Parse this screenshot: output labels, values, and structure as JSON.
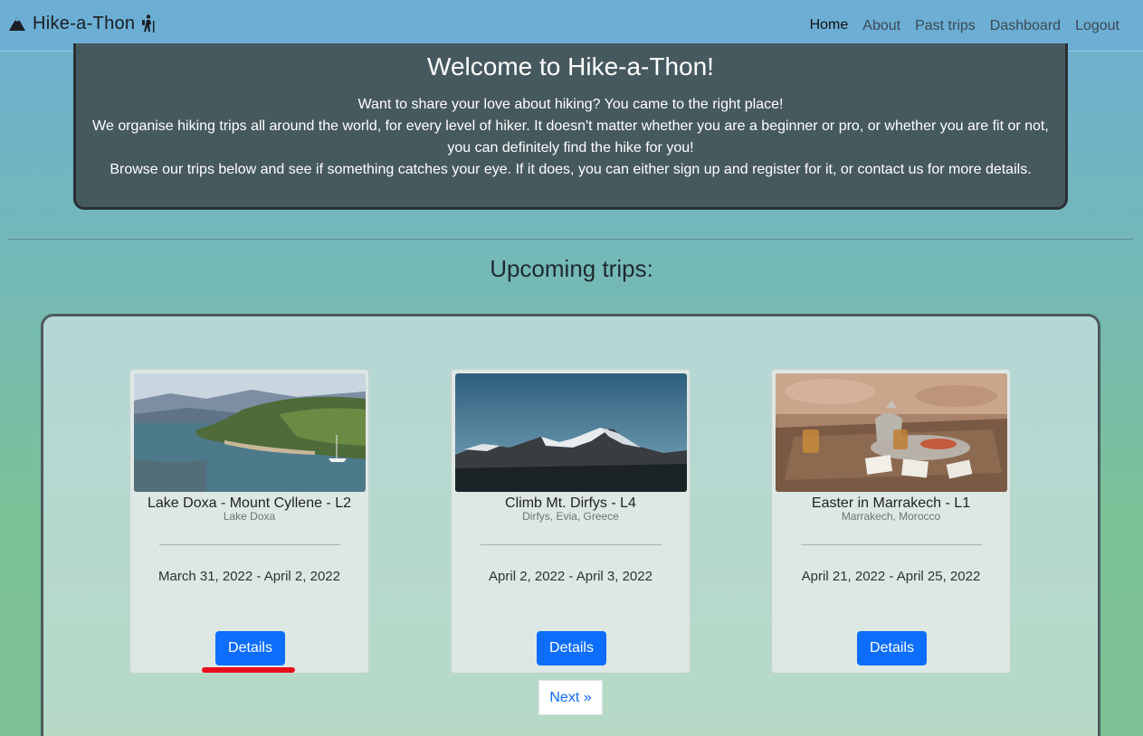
{
  "navbar": {
    "brand": "Hike-a-Thon",
    "links": [
      "Home",
      "About",
      "Past trips",
      "Dashboard",
      "Logout"
    ],
    "active": "Home"
  },
  "welcome": {
    "title": "Welcome to Hike-a-Thon!",
    "line1": "Want to share your love about hiking? You came to the right place!",
    "line2": "We organise hiking trips all around the world, for every level of hiker. It doesn't matter whether you are a beginner or pro, or whether you are fit or not, you can definitely find the hike for you!",
    "line3": "Browse our trips below and see if something catches your eye. If it does, you can either sign up and register for it, or contact us for more details."
  },
  "section_title": "Upcoming trips:",
  "trips": [
    {
      "title": "Lake Doxa - Mount Cyllene - L2",
      "location": "Lake Doxa",
      "dates": "March 31, 2022 - April 2, 2022",
      "button": "Details",
      "image": "lake-landscape"
    },
    {
      "title": "Climb Mt. Dirfys - L4",
      "location": "Dirfys, Evia, Greece",
      "dates": "April 2, 2022 - April 3, 2022",
      "button": "Details",
      "image": "snowy-mountain"
    },
    {
      "title": "Easter in Marrakech - L1",
      "location": "Marrakech, Morocco",
      "dates": "April 21, 2022 - April 25, 2022",
      "button": "Details",
      "image": "moroccan-tea-table"
    }
  ],
  "pagination": {
    "next": "Next »"
  },
  "colors": {
    "primary": "#0d6efd",
    "navbar": "#6caed4",
    "welcome_bg": "#46595f",
    "highlight": "#e8101a"
  }
}
